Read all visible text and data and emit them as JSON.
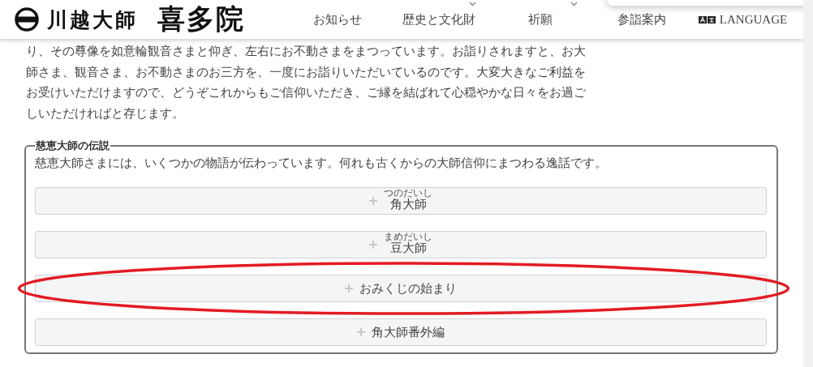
{
  "header": {
    "logo_text": "川越大師",
    "logo_name": "喜多院",
    "nav": [
      {
        "label": "お知らせ",
        "has_dropdown": false,
        "kind": "link"
      },
      {
        "label": "歴史と文化財",
        "has_dropdown": true,
        "kind": "link"
      },
      {
        "label": "祈願",
        "has_dropdown": true,
        "kind": "link"
      },
      {
        "label": "参詣案内",
        "has_dropdown": false,
        "kind": "link"
      },
      {
        "label": "LANGUAGE",
        "has_dropdown": false,
        "kind": "language"
      }
    ]
  },
  "intro": "り、その尊像を如意輪観音さまと仰ぎ、左右にお不動さまをまつっています。お詣りされますと、お大師さま、観音さま、お不動さまのお三方を、一度にお詣りいただいているのです。大変大きなご利益をお受けいただけますので、どうぞこれからもご信仰いただき、ご縁を結ばれて心穏やかな日々をお過ごしいただければと存じます。",
  "legend": {
    "title": "慈恵大師の伝説",
    "description": "慈恵大師さまには、いくつかの物語が伝わっています。何れも古くからの大師信仰にまつわる逸話です。",
    "items": [
      {
        "label": "角大師",
        "reading": "つのだいし",
        "expanded": false,
        "highlighted": false
      },
      {
        "label": "豆大師",
        "reading": "まめだいし",
        "expanded": false,
        "highlighted": false
      },
      {
        "label": "おみくじの始まり",
        "expanded": false,
        "highlighted": true
      },
      {
        "label": "角大師番外編",
        "expanded": false,
        "highlighted": false
      }
    ]
  }
}
